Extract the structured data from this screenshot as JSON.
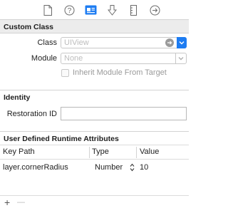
{
  "tabs": [
    {
      "icon": "file-inspector-icon"
    },
    {
      "icon": "quick-help-icon"
    },
    {
      "icon": "identity-inspector-icon",
      "active": true
    },
    {
      "icon": "attributes-inspector-icon"
    },
    {
      "icon": "size-inspector-icon"
    },
    {
      "icon": "connections-inspector-icon"
    }
  ],
  "custom_class": {
    "header": "Custom Class",
    "class_label": "Class",
    "class_placeholder": "UIView",
    "module_label": "Module",
    "module_placeholder": "None",
    "inherit_label": "Inherit Module From Target"
  },
  "identity": {
    "header": "Identity",
    "restoration_label": "Restoration ID",
    "restoration_value": ""
  },
  "runtime_attributes": {
    "header": "User Defined Runtime Attributes",
    "columns": [
      "Key Path",
      "Type",
      "Value"
    ],
    "rows": [
      {
        "key_path": "layer.cornerRadius",
        "type": "Number",
        "value": "10"
      }
    ],
    "add_label": "+",
    "remove_label": "—"
  },
  "colors": {
    "accent": "#1d7cf2",
    "section_bg": "#ececec"
  }
}
